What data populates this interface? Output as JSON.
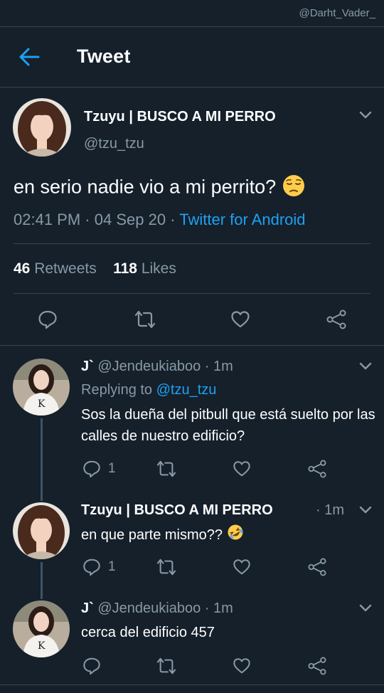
{
  "watermark": "@Darht_Vader_",
  "header": {
    "title": "Tweet",
    "back_icon": "arrow-left-icon"
  },
  "main_tweet": {
    "name": "Tzuyu | BUSCO A MI PERRO",
    "handle": "@tzu_tzu",
    "text": "en serio nadie vio a mi perrito?",
    "emoji": "pensive-face",
    "time": "02:41 PM",
    "date": "04 Sep 20",
    "source": "Twitter for Android",
    "retweets_count": "46",
    "retweets_label": "Retweets",
    "likes_count": "118",
    "likes_label": "Likes"
  },
  "replies": [
    {
      "name": "J`",
      "handle": "@Jendeukiaboo",
      "time": "1m",
      "replying_label": "Replying to",
      "replying_to": "@tzu_tzu",
      "text": "Sos la dueña del pitbull que está suelto por las calles de nuestro edificio?",
      "reply_count": "1"
    },
    {
      "name": "Tzuyu | BUSCO A MI PERRO",
      "time": "1m",
      "text": "en que parte mismo??",
      "emoji": "rolling-on-floor-laughing",
      "reply_count": "1"
    },
    {
      "name": "J`",
      "handle": "@Jendeukiaboo",
      "time": "1m",
      "text": "cerca del edificio 457",
      "reply_count": ""
    }
  ],
  "colors": {
    "background": "#15202b",
    "accent": "#1da1f2",
    "muted": "#8899a6",
    "divider": "#38444d"
  }
}
